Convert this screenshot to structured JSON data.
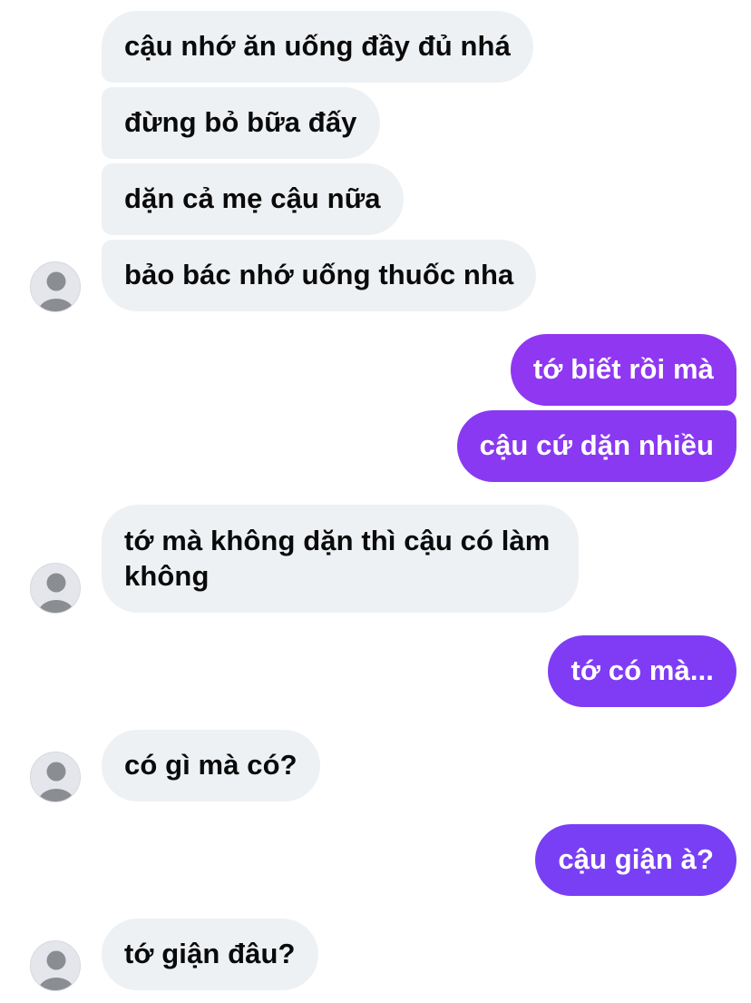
{
  "conversation": {
    "messages": [
      {
        "sender": "them",
        "text": "cậu nhớ ăn uống đầy đủ nhá"
      },
      {
        "sender": "them",
        "text": "đừng bỏ bữa đấy"
      },
      {
        "sender": "them",
        "text": "dặn cả mẹ cậu nữa"
      },
      {
        "sender": "them",
        "text": "bảo bác nhớ uống thuốc nha"
      },
      {
        "sender": "me",
        "text": "tớ biết rồi mà"
      },
      {
        "sender": "me",
        "text": "cậu cứ dặn nhiều"
      },
      {
        "sender": "them",
        "text": "tớ mà không dặn thì cậu có làm\nkhông"
      },
      {
        "sender": "me",
        "text": "tớ có mà..."
      },
      {
        "sender": "them",
        "text": "có gì mà có?"
      },
      {
        "sender": "me",
        "text": "cậu giận à?"
      },
      {
        "sender": "them",
        "text": "tớ giận đâu?"
      }
    ]
  },
  "colors": {
    "incoming_bubble": "#eef1f4",
    "incoming_text": "#0a0a0a",
    "outgoing_gradient_top": "#9b34ef",
    "outgoing_gradient_bottom": "#7a3ff5",
    "outgoing_text": "#ffffff",
    "avatar_bg": "#e4e6eb",
    "avatar_figure": "#8a8d91"
  },
  "icons": {
    "avatar": "default-user-avatar-icon"
  }
}
